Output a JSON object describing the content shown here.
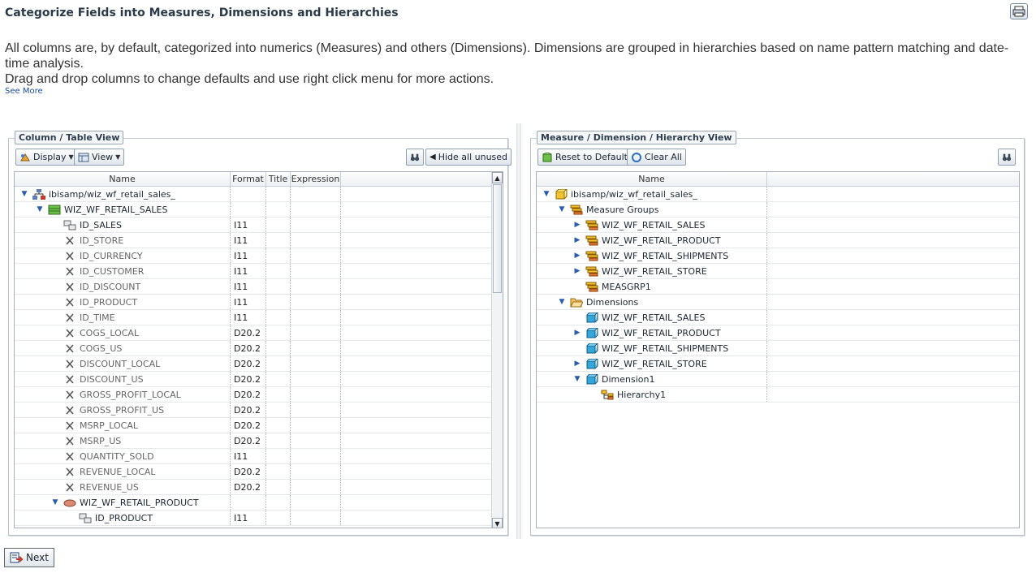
{
  "page": {
    "title": "Categorize Fields into Measures, Dimensions and Hierarchies",
    "description_1": "All columns are, by default, categorized into numerics (Measures) and others (Dimensions). Dimensions are grouped in hierarchies based on name pattern matching and date-time analysis.",
    "description_2": "Drag and drop columns to change defaults and use right click menu for more actions.",
    "see_more": "See More"
  },
  "left_panel": {
    "legend": "Column / Table View",
    "display_label": "Display",
    "view_label": "View",
    "hide_unused_label": "Hide all unused",
    "columns": [
      "Name",
      "Format",
      "Title",
      "Expression"
    ],
    "rows": [
      {
        "name": "ibisamp/wiz_wf_retail_sales_",
        "format": "",
        "icon": "database-icon",
        "toggle": "expanded",
        "level": 0
      },
      {
        "name": "WIZ_WF_RETAIL_SALES",
        "format": "",
        "icon": "table-icon",
        "toggle": "expanded",
        "level": 1
      },
      {
        "name": "ID_SALES",
        "format": "I11",
        "icon": "key-icon",
        "toggle": "",
        "level": 2
      },
      {
        "name": "ID_STORE",
        "format": "I11",
        "icon": "field-x-icon",
        "toggle": "",
        "level": 2
      },
      {
        "name": "ID_CURRENCY",
        "format": "I11",
        "icon": "field-x-icon",
        "toggle": "",
        "level": 2
      },
      {
        "name": "ID_CUSTOMER",
        "format": "I11",
        "icon": "field-x-icon",
        "toggle": "",
        "level": 2
      },
      {
        "name": "ID_DISCOUNT",
        "format": "I11",
        "icon": "field-x-icon",
        "toggle": "",
        "level": 2
      },
      {
        "name": "ID_PRODUCT",
        "format": "I11",
        "icon": "field-x-icon",
        "toggle": "",
        "level": 2
      },
      {
        "name": "ID_TIME",
        "format": "I11",
        "icon": "field-x-icon",
        "toggle": "",
        "level": 2
      },
      {
        "name": "COGS_LOCAL",
        "format": "D20.2",
        "icon": "field-x-icon",
        "toggle": "",
        "level": 2
      },
      {
        "name": "COGS_US",
        "format": "D20.2",
        "icon": "field-x-icon",
        "toggle": "",
        "level": 2
      },
      {
        "name": "DISCOUNT_LOCAL",
        "format": "D20.2",
        "icon": "field-x-icon",
        "toggle": "",
        "level": 2
      },
      {
        "name": "DISCOUNT_US",
        "format": "D20.2",
        "icon": "field-x-icon",
        "toggle": "",
        "level": 2
      },
      {
        "name": "GROSS_PROFIT_LOCAL",
        "format": "D20.2",
        "icon": "field-x-icon",
        "toggle": "",
        "level": 2
      },
      {
        "name": "GROSS_PROFIT_US",
        "format": "D20.2",
        "icon": "field-x-icon",
        "toggle": "",
        "level": 2
      },
      {
        "name": "MSRP_LOCAL",
        "format": "D20.2",
        "icon": "field-x-icon",
        "toggle": "",
        "level": 2
      },
      {
        "name": "MSRP_US",
        "format": "D20.2",
        "icon": "field-x-icon",
        "toggle": "",
        "level": 2
      },
      {
        "name": "QUANTITY_SOLD",
        "format": "I11",
        "icon": "field-x-icon",
        "toggle": "",
        "level": 2
      },
      {
        "name": "REVENUE_LOCAL",
        "format": "D20.2",
        "icon": "field-x-icon",
        "toggle": "",
        "level": 2
      },
      {
        "name": "REVENUE_US",
        "format": "D20.2",
        "icon": "field-x-icon",
        "toggle": "",
        "level": 2
      },
      {
        "name": "WIZ_WF_RETAIL_PRODUCT",
        "format": "",
        "icon": "linked-table-icon",
        "toggle": "expanded",
        "level": 2
      },
      {
        "name": "ID_PRODUCT",
        "format": "I11",
        "icon": "key-icon",
        "toggle": "",
        "level": 3
      }
    ]
  },
  "right_panel": {
    "legend": "Measure / Dimension / Hierarchy View",
    "reset_label": "Reset to Default",
    "clear_label": "Clear All",
    "columns": [
      "Name"
    ],
    "rows": [
      {
        "name": "ibisamp/wiz_wf_retail_sales_",
        "icon": "cube-icon",
        "toggle": "expanded",
        "level": 0
      },
      {
        "name": "Measure Groups",
        "icon": "measure-groups-icon",
        "toggle": "expanded",
        "level": 1
      },
      {
        "name": "WIZ_WF_RETAIL_SALES",
        "icon": "measure-group-icon",
        "toggle": "collapsed",
        "level": 2
      },
      {
        "name": "WIZ_WF_RETAIL_PRODUCT",
        "icon": "measure-group-icon",
        "toggle": "collapsed",
        "level": 2
      },
      {
        "name": "WIZ_WF_RETAIL_SHIPMENTS",
        "icon": "measure-group-icon",
        "toggle": "collapsed",
        "level": 2
      },
      {
        "name": "WIZ_WF_RETAIL_STORE",
        "icon": "measure-group-icon",
        "toggle": "collapsed",
        "level": 2
      },
      {
        "name": "MEASGRP1",
        "icon": "measure-group-icon",
        "toggle": "",
        "level": 2
      },
      {
        "name": "Dimensions",
        "icon": "folder-open-icon",
        "toggle": "expanded",
        "level": 1
      },
      {
        "name": "WIZ_WF_RETAIL_SALES",
        "icon": "dimension-icon",
        "toggle": "",
        "level": 2
      },
      {
        "name": "WIZ_WF_RETAIL_PRODUCT",
        "icon": "dimension-icon",
        "toggle": "collapsed",
        "level": 2
      },
      {
        "name": "WIZ_WF_RETAIL_SHIPMENTS",
        "icon": "dimension-icon",
        "toggle": "",
        "level": 2
      },
      {
        "name": "WIZ_WF_RETAIL_STORE",
        "icon": "dimension-icon",
        "toggle": "collapsed",
        "level": 2
      },
      {
        "name": "Dimension1",
        "icon": "dimension-icon",
        "toggle": "expanded",
        "level": 2
      },
      {
        "name": "Hierarchy1",
        "icon": "hierarchy-icon",
        "toggle": "",
        "level": 3
      }
    ]
  },
  "footer": {
    "next_label": "Next"
  },
  "colors": {
    "title": "#2b3a4a",
    "link": "#1b4aa8",
    "toggle": "#2a5db0"
  }
}
